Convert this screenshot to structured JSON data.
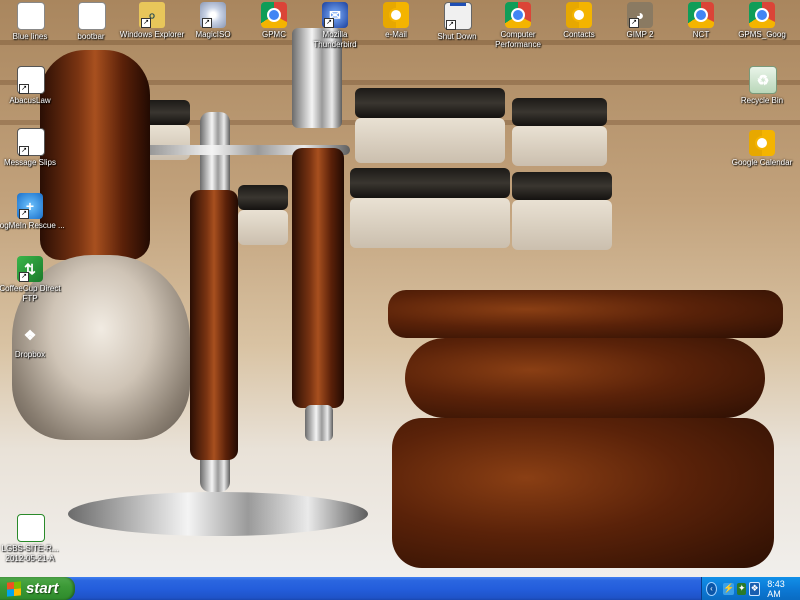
{
  "desktop": {
    "icons": [
      {
        "label": "Blue lines",
        "icon": "document-icon"
      },
      {
        "label": "bootbar",
        "icon": "document-icon"
      },
      {
        "label": "Windows Explorer",
        "icon": "windows-explorer-icon"
      },
      {
        "label": "MagicISO",
        "icon": "magiciso-icon"
      },
      {
        "label": "GPMC",
        "icon": "chrome-icon"
      },
      {
        "label": "Mozilla Thunderbird",
        "icon": "thunderbird-icon"
      },
      {
        "label": "e-Mail",
        "icon": "chrome-icon"
      },
      {
        "label": "Shut Down",
        "icon": "shutdown-icon"
      },
      {
        "label": "Computer Performance",
        "icon": "chrome-icon"
      },
      {
        "label": "Contacts",
        "icon": "chrome-icon"
      },
      {
        "label": "GIMP 2",
        "icon": "gimp-icon"
      },
      {
        "label": "NCT",
        "icon": "chrome-icon"
      },
      {
        "label": "GPMS_Goog",
        "icon": "chrome-icon"
      },
      {
        "label": "AbacusLaw",
        "icon": "abacuslaw-icon"
      },
      {
        "label": "Message Slips",
        "icon": "abacuslaw-icon"
      },
      {
        "label": "LogMeIn Rescue ...",
        "icon": "logmein-icon"
      },
      {
        "label": "CoffeeCup Direct FTP",
        "icon": "ftp-icon"
      },
      {
        "label": "Dropbox",
        "icon": "dropbox-icon"
      },
      {
        "label": "LGBS-SITE-R... 2012-05-21-A",
        "icon": "spreadsheet-icon"
      },
      {
        "label": "Recycle Bin",
        "icon": "recycle-bin-icon"
      },
      {
        "label": "Google Calendar",
        "icon": "google-calendar-icon"
      }
    ]
  },
  "taskbar": {
    "start_label": "start",
    "clock": "8:43 AM"
  },
  "colors": {
    "taskbar_blue": "#245edc",
    "start_green": "#3c9a37",
    "tray_blue": "#0c7ad6"
  }
}
